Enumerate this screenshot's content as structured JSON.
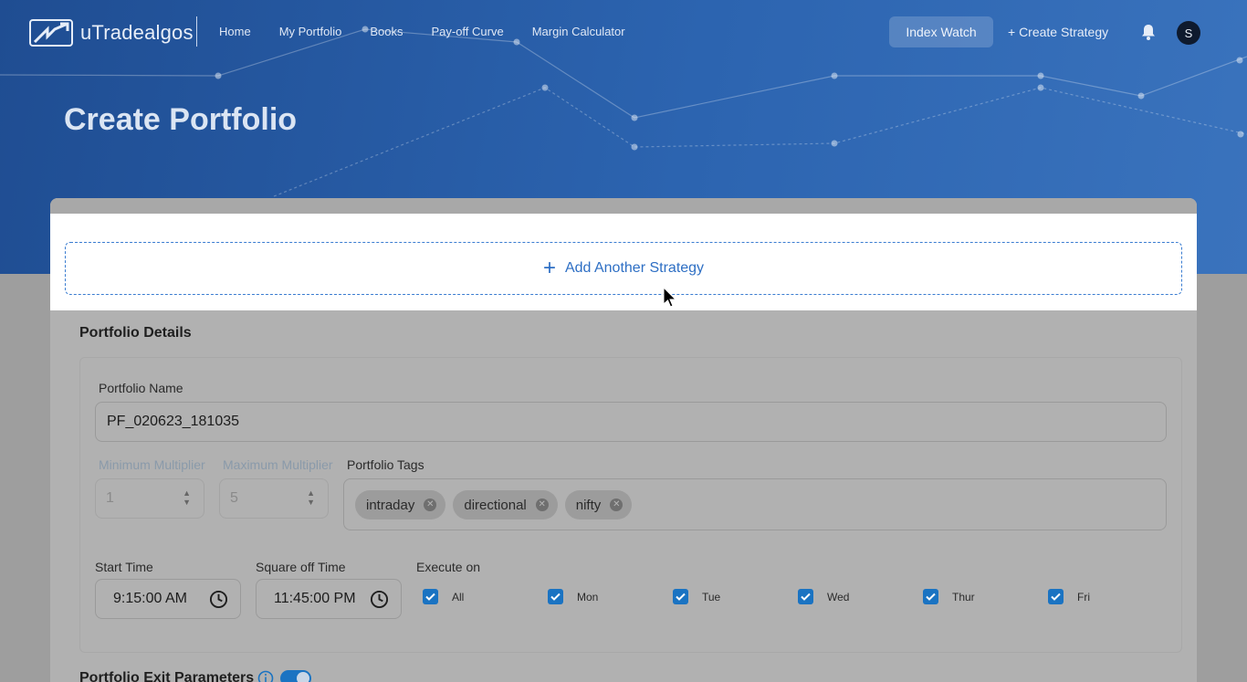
{
  "brand": {
    "name_bold": "uTrade",
    "name_light": "algos"
  },
  "nav": {
    "items": [
      "Home",
      "My Portfolio",
      "Books",
      "Pay-off Curve",
      "Margin Calculator"
    ]
  },
  "header": {
    "index_watch": "Index Watch",
    "create_strategy": "+ Create Strategy",
    "avatar_letter": "S"
  },
  "page": {
    "title": "Create Portfolio"
  },
  "add_strategy": {
    "label": "Add Another Strategy"
  },
  "portfolio_details": {
    "section_title": "Portfolio Details",
    "name_label": "Portfolio Name",
    "name_value": "PF_020623_181035",
    "min_multiplier_label": "Minimum Multiplier",
    "min_multiplier_value": "1",
    "max_multiplier_label": "Maximum Multiplier",
    "max_multiplier_value": "5",
    "tags_label": "Portfolio Tags",
    "tags": [
      "intraday",
      "directional",
      "nifty"
    ],
    "start_time_label": "Start Time",
    "start_time_value": "9:15:00 AM",
    "square_off_label": "Square off Time",
    "square_off_value": "11:45:00 PM",
    "execute_on_label": "Execute on",
    "days": [
      "All",
      "Mon",
      "Tue",
      "Wed",
      "Thur",
      "Fri"
    ]
  },
  "exit": {
    "title": "Portfolio Exit Parameters"
  },
  "colors": {
    "accent": "#1a73c2",
    "hero": "#2c64b0",
    "link": "#2e6fc4"
  }
}
